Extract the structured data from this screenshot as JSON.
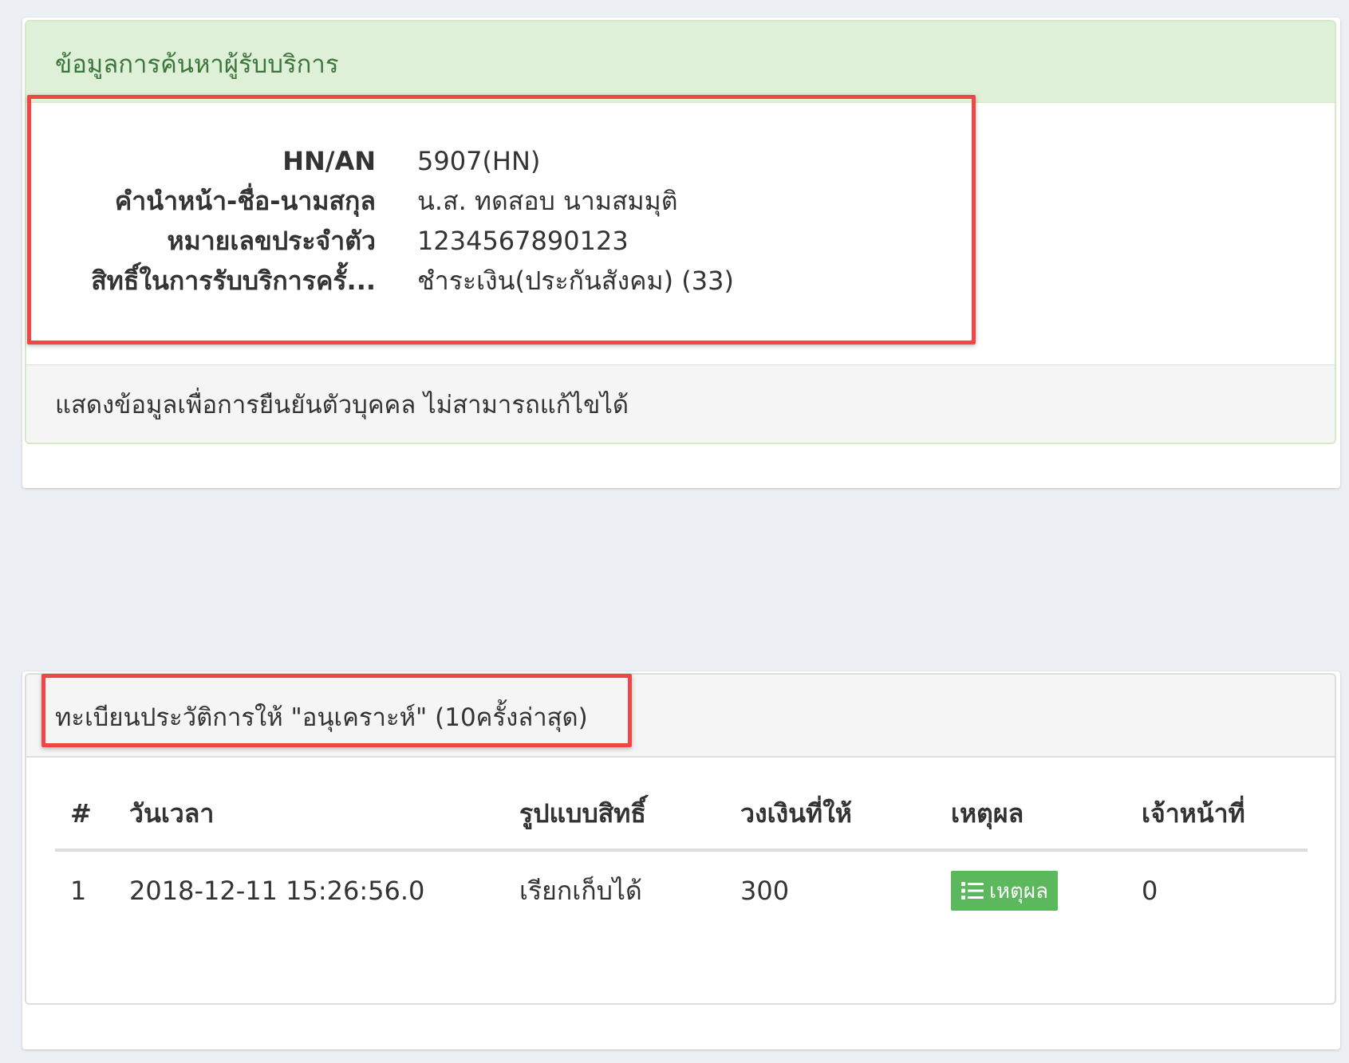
{
  "search_panel": {
    "title": "ข้อมูลการค้นหาผู้รับบริการ",
    "fields": [
      {
        "label": "HN/AN",
        "value": "5907(HN)"
      },
      {
        "label": "คำนำหน้า-ชื่อ-นามสกุล",
        "value": "น.ส. ทดสอบ นามสมมุติ"
      },
      {
        "label": "หมายเลขประจำตัว",
        "value": "1234567890123"
      },
      {
        "label": "สิทธิ์ในการรับบริการครั้...",
        "value": "ชำระเงิน(ประกันสังคม) (33)"
      }
    ],
    "footer": "แสดงข้อมูลเพื่อการยืนยันตัวบุคคล ไม่สามารถแก้ไขได้"
  },
  "history_panel": {
    "title": "ทะเบียนประวัติการให้ \"อนุเคราะห์\" (10ครั้งล่าสุด)",
    "columns": [
      "#",
      "วันเวลา",
      "รูปแบบสิทธิ์",
      "วงเงินที่ให้",
      "เหตุผล",
      "เจ้าหน้าที่"
    ],
    "rows": [
      {
        "no": "1",
        "datetime": "2018-12-11 15:26:56.0",
        "right_type": "เรียกเก็บได้",
        "amount": "300",
        "reason_button": "เหตุผล",
        "staff": "0"
      }
    ]
  },
  "icons": {
    "reason_button_icon": "list-icon"
  },
  "colors": {
    "success_heading_bg": "#dff0d8",
    "success_heading_text": "#3c763d",
    "button_green": "#5cb85c",
    "highlight_red": "#f04646"
  }
}
